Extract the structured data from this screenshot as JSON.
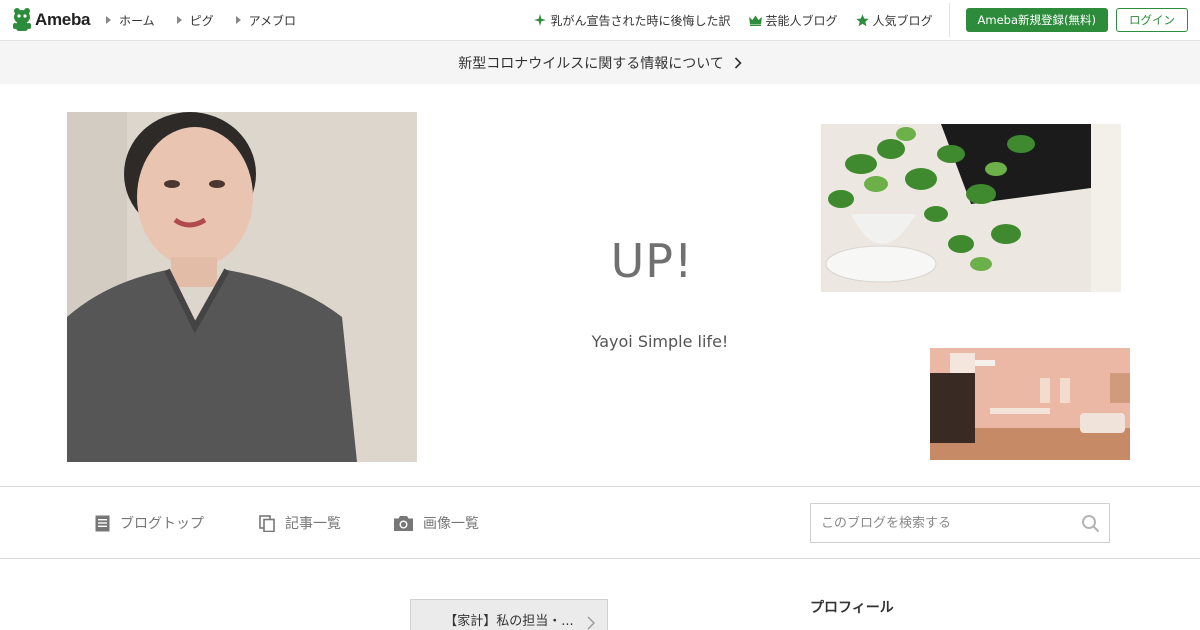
{
  "topbar": {
    "logo_text": "Ameba",
    "nav_left": [
      {
        "label": "ホーム"
      },
      {
        "label": "ピグ"
      },
      {
        "label": "アメブロ"
      }
    ],
    "nav_right": [
      {
        "label": "乳がん宣告された時に後悔した訳",
        "icon": "sparkle-icon"
      },
      {
        "label": "芸能人ブログ",
        "icon": "crown-icon"
      },
      {
        "label": "人気ブログ",
        "icon": "star-icon"
      }
    ],
    "register_label": "Ameba新規登録(無料)",
    "login_label": "ログイン"
  },
  "banner": {
    "text": "新型コロナウイルスに関する情報について"
  },
  "header": {
    "title": "UP!",
    "description": "Yayoi Simple life!"
  },
  "blog_menu": {
    "items": [
      {
        "label": "ブログトップ",
        "icon": "document-icon"
      },
      {
        "label": "記事一覧",
        "icon": "copy-icon"
      },
      {
        "label": "画像一覧",
        "icon": "camera-icon"
      }
    ],
    "search_placeholder": "このブログを検索する"
  },
  "content": {
    "article_nav_label": "【家計】私の担当・...",
    "profile_heading": "プロフィール"
  },
  "colors": {
    "brand_green": "#2d8c3c",
    "banner_bg": "#f5f5f5"
  }
}
